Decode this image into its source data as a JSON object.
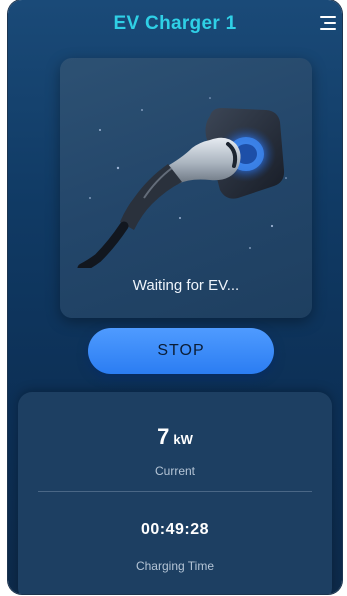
{
  "header": {
    "title": "EV Charger 1",
    "menu_icon": "hamburger-menu-icon"
  },
  "hero": {
    "illustration": "ev-charging-plug-illustration",
    "status": "Waiting for EV..."
  },
  "actions": {
    "stop_label": "STOP"
  },
  "stats": {
    "power_value": "7",
    "power_unit": "kW",
    "power_caption": "Current",
    "time_value": "00:49:28",
    "time_caption": "Charging Time"
  },
  "colors": {
    "title_accent": "#2fd0e6",
    "button_blue": "#2b7df2",
    "background_navy": "#0c2f55",
    "card": "#1d3f62"
  }
}
